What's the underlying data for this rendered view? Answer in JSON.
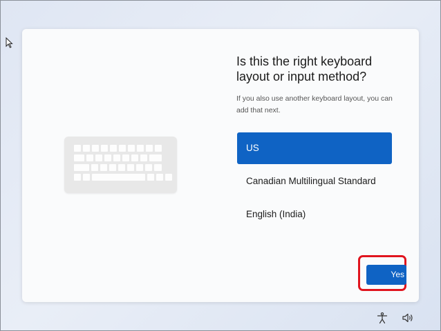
{
  "card": {
    "title": "Is this the right keyboard layout or input method?",
    "subtitle": "If you also use another keyboard layout, you can add that next."
  },
  "layouts": [
    {
      "label": "US",
      "selected": true
    },
    {
      "label": "Canadian Multilingual Standard",
      "selected": false
    },
    {
      "label": "English (India)",
      "selected": false
    }
  ],
  "actions": {
    "yes_label": "Yes"
  },
  "tray": {
    "accessibility_icon": "accessibility-icon",
    "volume_icon": "volume-icon"
  },
  "colors": {
    "accent": "#0f63c4",
    "highlight": "#e0141e"
  }
}
